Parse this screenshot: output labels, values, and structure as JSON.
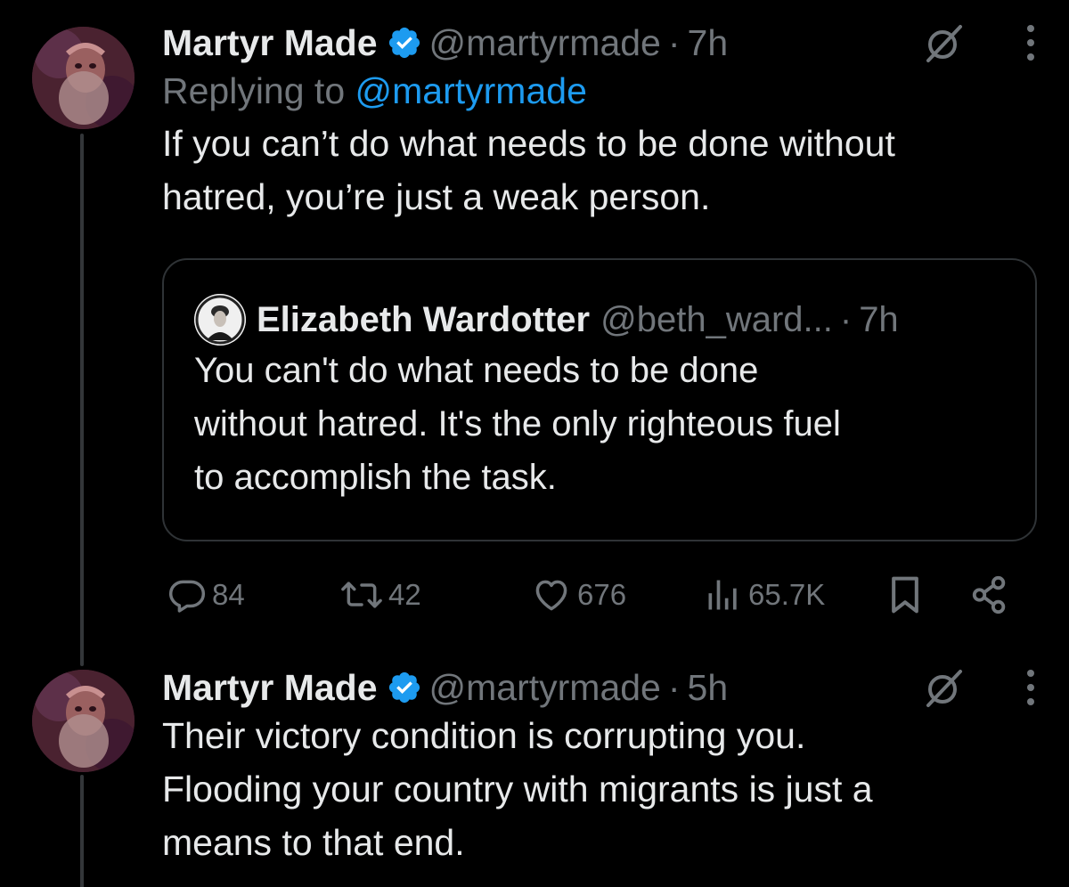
{
  "colors": {
    "background": "#000000",
    "text_primary": "#e7e9ea",
    "text_secondary": "#71767b",
    "accent": "#1d9bf0",
    "border": "#2f3336"
  },
  "tweet1": {
    "author_name": "Martyr Made",
    "verified_icon": "verified-badge-icon",
    "handle": "@martyrmade",
    "separator": "·",
    "time": "7h",
    "replying_prefix": "Replying to",
    "replying_to": "@martyrmade",
    "text_lines": [
      "If you can’t do what needs to be done without",
      "hatred, you’re just a weak person."
    ],
    "quote": {
      "author_name": "Elizabeth Wardotter",
      "handle": "@beth_ward...",
      "separator": "·",
      "time": "7h",
      "text_lines": [
        "You can't do what needs to be done",
        "without hatred. It's the only righteous fuel",
        "to accomplish the task."
      ]
    },
    "actions": {
      "replies": "84",
      "reposts": "42",
      "likes": "676",
      "views": "65.7K"
    }
  },
  "tweet2": {
    "author_name": "Martyr Made",
    "handle": "@martyrmade",
    "separator": "·",
    "time": "5h",
    "text_lines": [
      "Their victory condition is corrupting you.",
      "Flooding your country with migrants is just a",
      "means to that end."
    ]
  }
}
